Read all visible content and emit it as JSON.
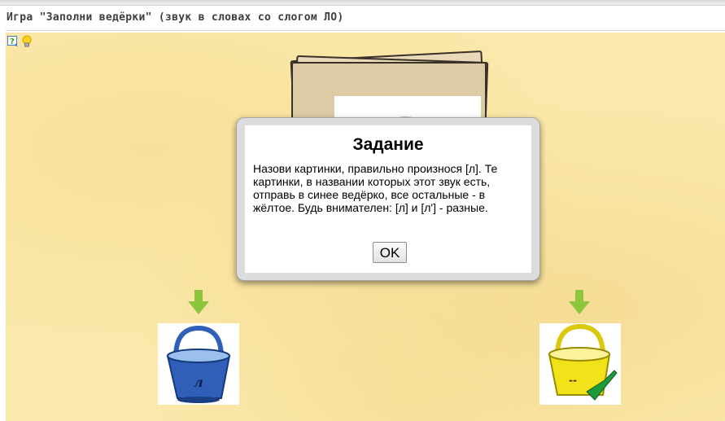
{
  "page": {
    "title": "Игра \"Заполни ведёрки\" (звук в словах со слогом ЛО)"
  },
  "toolbar": {
    "help_icon": "help-question-icon",
    "hint_icon": "lightbulb-icon"
  },
  "cards": {
    "current_picture_icon": "thimble-icon"
  },
  "buckets": {
    "blue": {
      "label": "л",
      "color": "#2f5fb8",
      "icon": "blue-bucket-icon"
    },
    "yellow": {
      "label": "--",
      "color": "#f2e21a",
      "icon": "yellow-bucket-icon"
    }
  },
  "dialog": {
    "title": "Задание",
    "text": "Назови картинки, правильно произнося [л]. Те картинки, в названии которых этот звук есть, отправь в синее ведёрко, все остальные - в жёлтое. Будь внимателен: [л] и [л'] - разные.",
    "ok_label": "OK"
  },
  "colors": {
    "background": "#fbe9ac",
    "arrow": "#8cc63f"
  }
}
